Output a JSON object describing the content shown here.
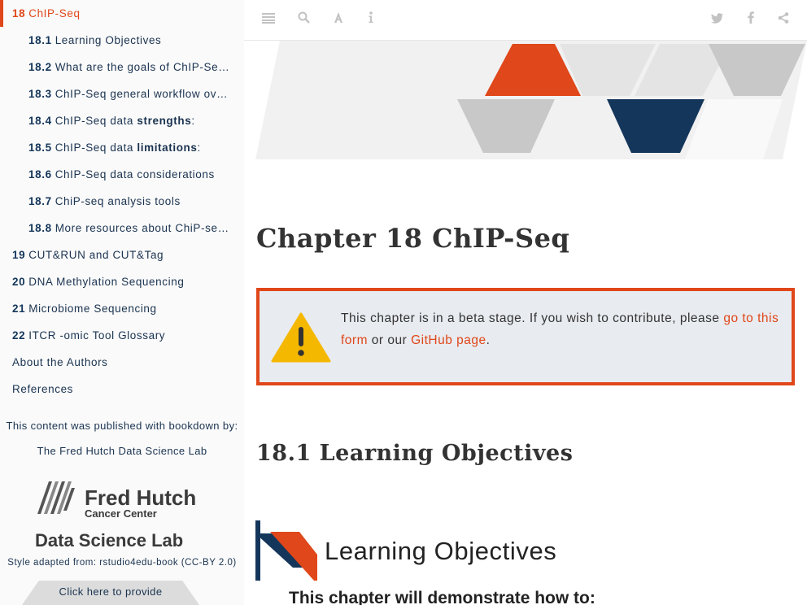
{
  "sidebar": {
    "toc": [
      {
        "num": "18",
        "label": "ChIP-Seq",
        "level": 1,
        "active": true
      },
      {
        "num": "18.1",
        "label": "Learning Objectives",
        "level": 2
      },
      {
        "num": "18.2",
        "label": "What are the goals of ChIP-Seq a…",
        "level": 2
      },
      {
        "num": "18.3",
        "label": "ChIP-Seq general workflow overv…",
        "level": 2
      },
      {
        "num": "18.4",
        "label_pre": "ChIP-Seq data ",
        "label_bold": "strengths",
        "label_post": ":",
        "level": 2
      },
      {
        "num": "18.5",
        "label_pre": "ChIP-Seq data ",
        "label_bold": "limitations",
        "label_post": ":",
        "level": 2
      },
      {
        "num": "18.6",
        "label": "ChIP-Seq data considerations",
        "level": 2
      },
      {
        "num": "18.7",
        "label": "ChiP-seq analysis tools",
        "level": 2
      },
      {
        "num": "18.8",
        "label": "More resources about ChiP-seq …",
        "level": 2
      },
      {
        "num": "19",
        "label": "CUT&RUN and CUT&Tag",
        "level": 1
      },
      {
        "num": "20",
        "label": "DNA Methylation Sequencing",
        "level": 1
      },
      {
        "num": "21",
        "label": "Microbiome Sequencing",
        "level": 1
      },
      {
        "num": "22",
        "label": "ITCR -omic Tool Glossary",
        "level": 1
      },
      {
        "num": "",
        "label": "About the Authors",
        "level": 1
      },
      {
        "num": "",
        "label": "References",
        "level": 1
      }
    ],
    "published_text": "This content was published with bookdown by:",
    "lab_name": "The Fred Hutch Data Science Lab",
    "logo": {
      "line1": "Fred Hutch",
      "line2": "Cancer Center",
      "line3": "Data Science Lab"
    },
    "style_text": "Style adapted from: rstudio4edu-book (CC-BY 2.0)",
    "feedback_label": "Click here to provide"
  },
  "toolbar": {
    "icons": [
      "menu-icon",
      "search-icon",
      "font-icon",
      "info-icon",
      "twitter-icon",
      "facebook-icon",
      "share-icon"
    ]
  },
  "main": {
    "chapter_title": "Chapter 18   ChIP-Seq",
    "notice": {
      "text_pre": "This chapter is in a beta stage. If you wish to contribute, please ",
      "link1": "go to this form",
      "text_mid": " or our ",
      "link2": "GitHub page",
      "text_post": "."
    },
    "section_title": "18.1   Learning Objectives",
    "lo_title": "Learning Objectives",
    "lo_sub": "This chapter will demonstrate how to:"
  },
  "colors": {
    "accent": "#e0471a",
    "navy": "#14365a",
    "gray": "#dcdcdc"
  }
}
